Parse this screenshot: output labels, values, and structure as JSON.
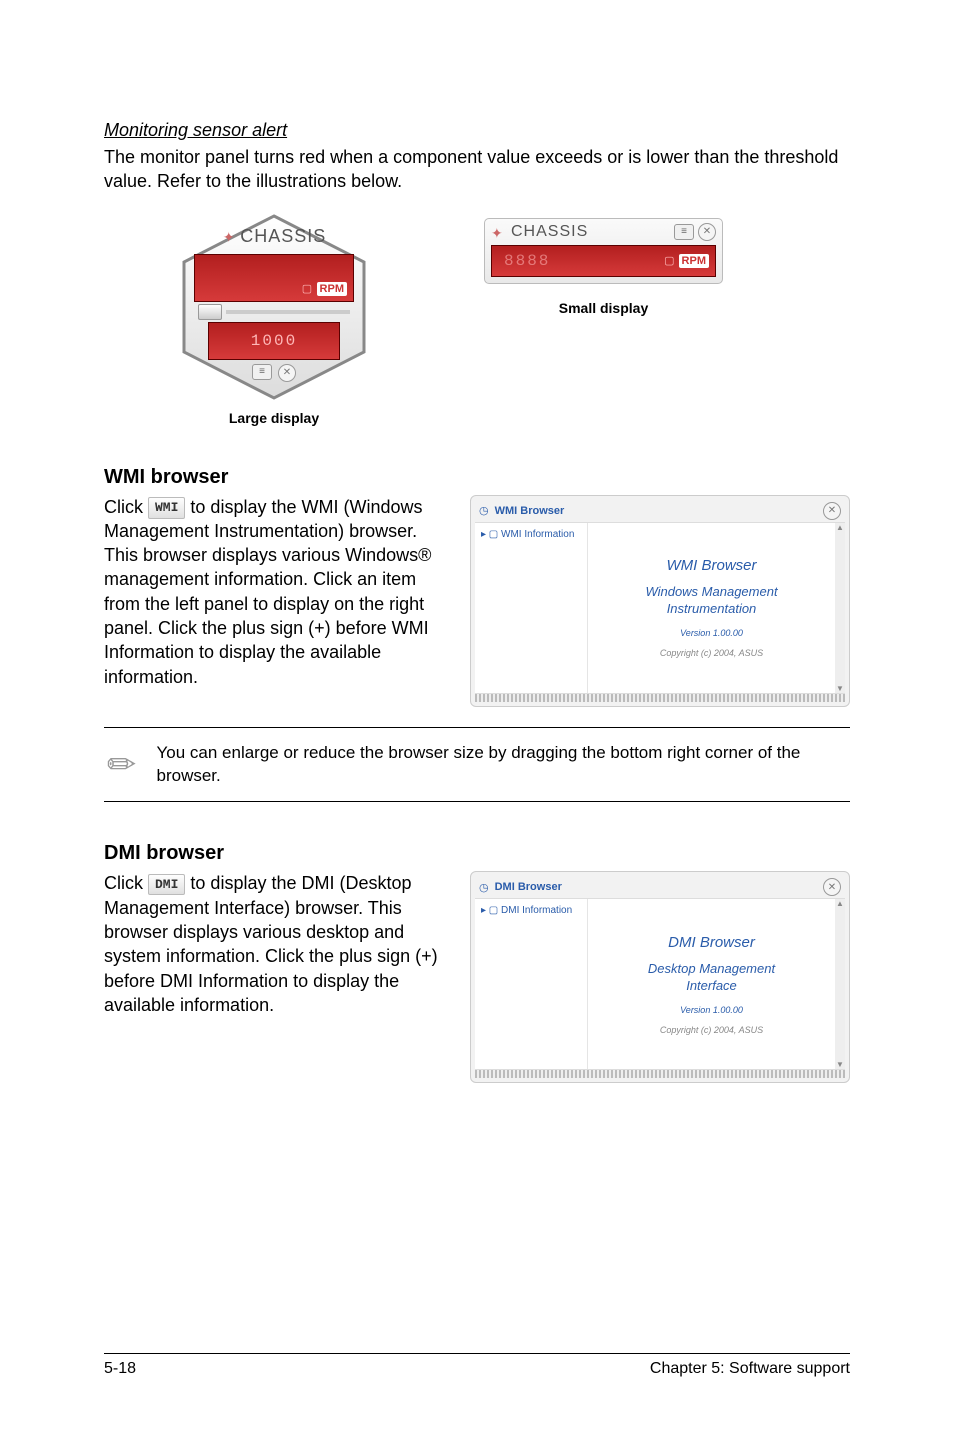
{
  "monitoring": {
    "heading": "Monitoring sensor alert",
    "body": "The monitor panel turns red when a component value exceeds or is lower than the threshold value. Refer to the illustrations below.",
    "large": {
      "label": "CHASSIS",
      "rpm_tag": "RPM",
      "value_upper": "",
      "value_lower": "1000",
      "caption": "Large display"
    },
    "small": {
      "label": "CHASSIS",
      "rpm_tag": "RPM",
      "value": "8888",
      "caption": "Small display"
    }
  },
  "wmi": {
    "heading": "WMI browser",
    "button_label": "WMI",
    "text_a": "Click ",
    "text_b": " to display the WMI (Windows Management Instrumentation) browser. This browser displays various Windows® management information. Click an item from the left panel to display on the right panel. Click the plus sign (+) before WMI Information to display the available information.",
    "shot": {
      "window_title": "WMI Browser",
      "tree_root": "WMI Information",
      "content_title": "WMI Browser",
      "content_sub": "Windows Management\nInstrumentation",
      "version": "Version 1.00.00",
      "copyright": "Copyright (c) 2004, ASUS"
    }
  },
  "note": {
    "text": "You can enlarge or reduce the browser size by dragging the bottom right corner of the browser."
  },
  "dmi": {
    "heading": "DMI browser",
    "button_label": "DMI",
    "text_a": "Click ",
    "text_b": " to display the DMI (Desktop Management Interface) browser. This browser displays various desktop and system information. Click the plus sign (+) before DMI Information to display the available information.",
    "shot": {
      "window_title": "DMI Browser",
      "tree_root": "DMI Information",
      "content_title": "DMI Browser",
      "content_sub": "Desktop Management\nInterface",
      "version": "Version 1.00.00",
      "copyright": "Copyright (c) 2004, ASUS"
    }
  },
  "footer": {
    "left": "5-18",
    "right": "Chapter 5: Software support"
  }
}
